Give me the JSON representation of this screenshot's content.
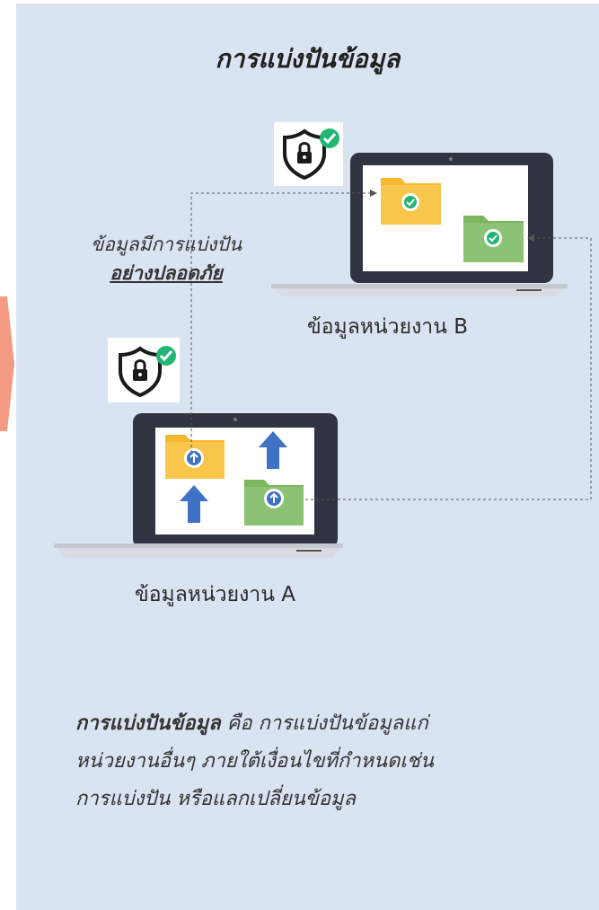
{
  "title": "การแบ่งปันข้อมูล",
  "side_caption": {
    "line1": "ข้อมูลมีการแบ่งปัน",
    "line2": "อย่างปลอดภัย"
  },
  "laptop_b_label": "ข้อมูลหน่วยงาน B",
  "laptop_a_label": "ข้อมูลหน่วยงาน A",
  "description": {
    "term": "การแบ่งปันข้อมูล",
    "line1_rest": " คือ การแบ่งปันข้อมูลแก่",
    "line2": "หน่วยงานอื่นๆ ภายใต้เงื่อนไขที่กำหนดเช่น",
    "line3": "การแบ่งปัน หรือแลกเปลี่ยนข้อมูล"
  },
  "colors": {
    "background": "#dae3f1",
    "folder_yellow": "#f5b82e",
    "folder_green": "#7bb661",
    "arrow_blue": "#3f72c4",
    "check_green": "#22b573",
    "laptop_dark": "#2f3440",
    "edge_orange": "#f59a82"
  },
  "icons": [
    "shield-lock-check-icon",
    "folder-check-icon",
    "folder-upload-icon",
    "up-arrow-icon"
  ]
}
